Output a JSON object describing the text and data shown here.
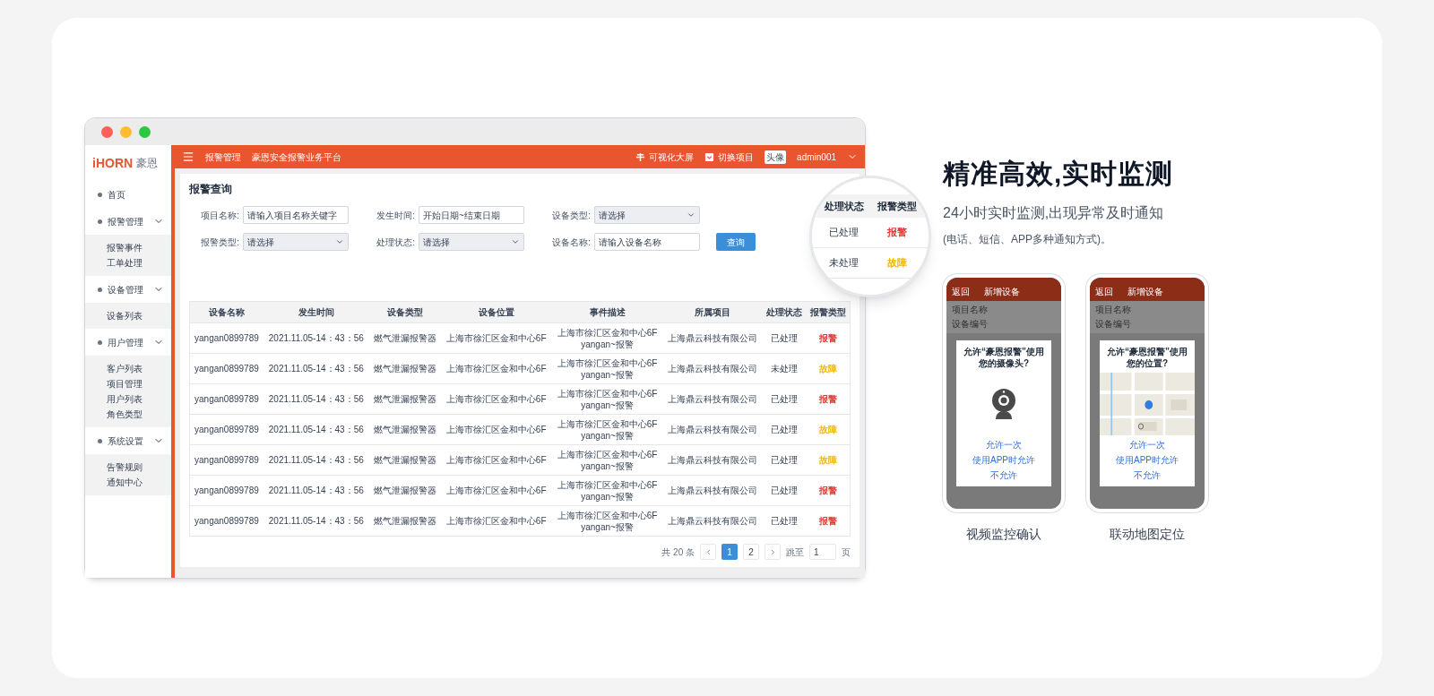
{
  "app": {
    "logo": {
      "brand": "iHORN",
      "name": "豪恩"
    },
    "header": {
      "section": "报警管理",
      "platform": "豪恩安全报警业务平台",
      "actions": [
        {
          "kind": "screen",
          "label": "可视化大屏"
        },
        {
          "kind": "switch",
          "label": "切换项目"
        }
      ],
      "avatar": "头像",
      "user": "admin001"
    },
    "sidebar": [
      {
        "label": "首页"
      },
      {
        "label": "报警管理",
        "expanded": true,
        "children": [
          {
            "label": "报警事件"
          },
          {
            "label": "工单处理"
          }
        ]
      },
      {
        "label": "设备管理",
        "expanded": true,
        "children": [
          {
            "label": "设备列表"
          }
        ]
      },
      {
        "label": "用户管理",
        "expanded": true,
        "children": [
          {
            "label": "客户列表"
          },
          {
            "label": "项目管理"
          },
          {
            "label": "用户列表"
          },
          {
            "label": "角色类型"
          }
        ]
      },
      {
        "label": "系统设置",
        "expanded": true,
        "children": [
          {
            "label": "告警规则"
          },
          {
            "label": "通知中心"
          }
        ]
      }
    ],
    "page_title": "报警查询",
    "filters": [
      {
        "kind": "input",
        "label": "项目名称:",
        "placeholder": "请输入项目名称关键字"
      },
      {
        "kind": "input",
        "label": "发生时间:",
        "placeholder": "开始日期~结束日期"
      },
      {
        "kind": "select",
        "label": "设备类型:",
        "value": "请选择"
      },
      {
        "kind": "select",
        "label": "报警类型:",
        "value": "请选择"
      },
      {
        "kind": "select",
        "label": "处理状态:",
        "value": "请选择"
      },
      {
        "kind": "input",
        "label": "设备名称:",
        "placeholder": "请输入设备名称"
      }
    ],
    "query_button": "查询",
    "table": {
      "columns": [
        "设备名称",
        "发生时间",
        "设备类型",
        "设备位置",
        "事件描述",
        "所属项目",
        "处理状态",
        "报警类型"
      ],
      "rows": [
        {
          "cells": [
            "yangan0899789",
            "2021.11.05-14：43：56",
            "燃气泄漏报警器",
            "上海市徐汇区金和中心6F",
            "上海市徐汇区金和中心6F\nyangan~报警",
            "上海鼎云科技有限公司",
            "已处理"
          ],
          "alarm": {
            "text": "报警",
            "color": "#e53935"
          }
        },
        {
          "cells": [
            "yangan0899789",
            "2021.11.05-14：43：56",
            "燃气泄漏报警器",
            "上海市徐汇区金和中心6F",
            "上海市徐汇区金和中心6F\nyangan~报警",
            "上海鼎云科技有限公司",
            "未处理"
          ],
          "alarm": {
            "text": "故障",
            "color": "#f2b705"
          }
        },
        {
          "cells": [
            "yangan0899789",
            "2021.11.05-14：43：56",
            "燃气泄漏报警器",
            "上海市徐汇区金和中心6F",
            "上海市徐汇区金和中心6F\nyangan~报警",
            "上海鼎云科技有限公司",
            "已处理"
          ],
          "alarm": {
            "text": "报警",
            "color": "#e53935"
          }
        },
        {
          "cells": [
            "yangan0899789",
            "2021.11.05-14：43：56",
            "燃气泄漏报警器",
            "上海市徐汇区金和中心6F",
            "上海市徐汇区金和中心6F\nyangan~报警",
            "上海鼎云科技有限公司",
            "已处理"
          ],
          "alarm": {
            "text": "故障",
            "color": "#f2b705"
          }
        },
        {
          "cells": [
            "yangan0899789",
            "2021.11.05-14：43：56",
            "燃气泄漏报警器",
            "上海市徐汇区金和中心6F",
            "上海市徐汇区金和中心6F\nyangan~报警",
            "上海鼎云科技有限公司",
            "已处理"
          ],
          "alarm": {
            "text": "故障",
            "color": "#f2b705"
          }
        },
        {
          "cells": [
            "yangan0899789",
            "2021.11.05-14：43：56",
            "燃气泄漏报警器",
            "上海市徐汇区金和中心6F",
            "上海市徐汇区金和中心6F\nyangan~报警",
            "上海鼎云科技有限公司",
            "已处理"
          ],
          "alarm": {
            "text": "报警",
            "color": "#e53935"
          }
        },
        {
          "cells": [
            "yangan0899789",
            "2021.11.05-14：43：56",
            "燃气泄漏报警器",
            "上海市徐汇区金和中心6F",
            "上海市徐汇区金和中心6F\nyangan~报警",
            "上海鼎云科技有限公司",
            "已处理"
          ],
          "alarm": {
            "text": "报警",
            "color": "#e53935"
          }
        }
      ]
    },
    "pagination": {
      "total": "共 20 条",
      "pages": [
        {
          "label": "1",
          "selected": true
        },
        {
          "label": "2",
          "selected": false
        }
      ],
      "goto": "跳至",
      "goto_value": "1",
      "unit": "页"
    },
    "magnifier": {
      "columns": [
        "处理状态",
        "报警类型"
      ],
      "rows": [
        {
          "status": "已处理",
          "alarm": {
            "text": "报警",
            "color": "#e53935"
          }
        },
        {
          "status": "未处理",
          "alarm": {
            "text": "故障",
            "color": "#f2b705"
          }
        }
      ]
    }
  },
  "feature": {
    "title": "精准高效,实时监测",
    "subtitle": "24小时实时监测,出现异常及时通知",
    "note": "(电话、短信、APP多种通知方式)。"
  },
  "phones": [
    {
      "kind": "camera",
      "back": "返回",
      "screen_title": "新增设备",
      "fields": [
        "项目名称",
        "设备编号"
      ],
      "prompt": "允许“豪恩报警”使用您的摄像头?",
      "options": [
        "允许一次",
        "使用APP时允许",
        "不允许"
      ],
      "caption": "视频监控确认"
    },
    {
      "kind": "map",
      "back": "返回",
      "screen_title": "新增设备",
      "fields": [
        "项目名称",
        "设备编号"
      ],
      "prompt": "允许“豪恩报警”使用您的位置?",
      "options": [
        "允许一次",
        "使用APP时允许",
        "不允许"
      ],
      "caption": "联动地图定位"
    }
  ]
}
